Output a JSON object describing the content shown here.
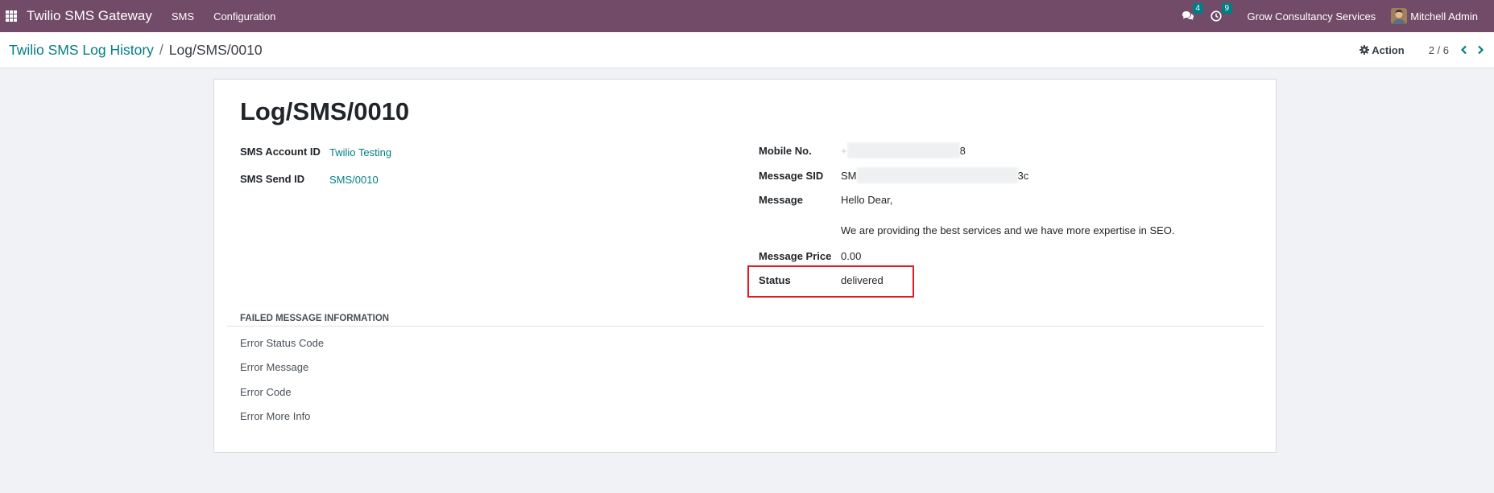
{
  "navbar": {
    "app_name": "Twilio SMS Gateway",
    "menus": [
      "SMS",
      "Configuration"
    ],
    "messages_count": "4",
    "activities_count": "9",
    "company": "Grow Consultancy Services",
    "user": "Mitchell Admin"
  },
  "breadcrumb": {
    "parent": "Twilio SMS Log History",
    "separator": "/",
    "current": "Log/SMS/0010"
  },
  "control": {
    "action_label": "Action",
    "pager": "2 / 6"
  },
  "record": {
    "title": "Log/SMS/0010",
    "left_fields": [
      {
        "label": "SMS Account ID",
        "value": "Twilio Testing"
      },
      {
        "label": "SMS Send ID",
        "value": "SMS/0010"
      }
    ],
    "mobile": {
      "label": "Mobile No.",
      "value_start": "+",
      "value_end": "8"
    },
    "sid": {
      "label": "Message SID",
      "value_start": "SM",
      "value_end": "3c"
    },
    "message": {
      "label": "Message",
      "line1": "Hello Dear,",
      "line2": "We are providing the best services and we have more expertise in SEO."
    },
    "price": {
      "label": "Message Price",
      "value": "0.00"
    },
    "status": {
      "label": "Status",
      "value": "delivered"
    }
  },
  "failed_section": {
    "title": "FAILED MESSAGE INFORMATION",
    "fields": [
      "Error Status Code",
      "Error Message",
      "Error Code",
      "Error More Info"
    ]
  },
  "colors": {
    "navbar": "#714b67",
    "link": "#017e84",
    "highlight": "#e01b24"
  }
}
